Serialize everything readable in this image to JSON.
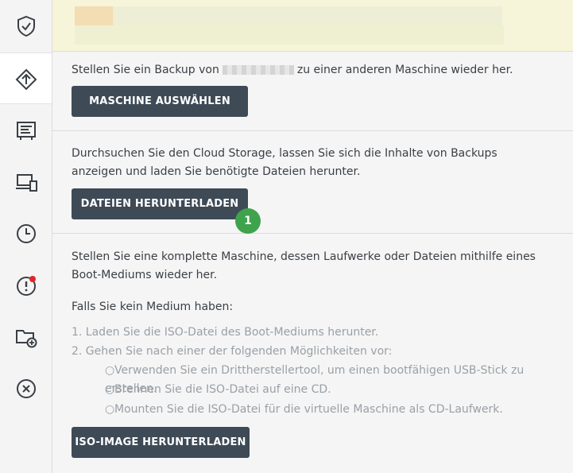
{
  "sidebar": {
    "items": [
      {
        "name": "shield-check-icon",
        "active": false
      },
      {
        "name": "restore-icon",
        "active": true
      },
      {
        "name": "backup-storage-icon",
        "active": false
      },
      {
        "name": "devices-icon",
        "active": false
      },
      {
        "name": "clock-icon",
        "active": false
      },
      {
        "name": "alert-icon",
        "active": false,
        "notification": true
      },
      {
        "name": "folder-add-icon",
        "active": false
      },
      {
        "name": "close-circle-icon",
        "active": false
      }
    ]
  },
  "section1": {
    "text_before": "Stellen Sie ein Backup von",
    "text_after": "zu einer anderen Maschine wieder her.",
    "button": "MASCHINE AUSWÄHLEN"
  },
  "section2": {
    "text": "Durchsuchen Sie den Cloud Storage, lassen Sie sich die Inhalte von Backups anzeigen und laden Sie benötigte Dateien herunter.",
    "button": "DATEIEN HERUNTERLADEN",
    "badge": "1"
  },
  "section3": {
    "text": "Stellen Sie eine komplette Maschine, dessen Laufwerke oder Dateien mithilfe eines Boot-Mediums wieder her.",
    "no_medium": "Falls Sie kein Medium haben:",
    "steps": [
      "1. Laden Sie die ISO-Datei des Boot-Mediums herunter.",
      "2. Gehen Sie nach einer der folgenden Möglichkeiten vor:"
    ],
    "bullets": [
      "Verwenden Sie ein Drittherstellertool, um einen bootfähigen USB-Stick zu erstellen.",
      "Brennen Sie die ISO-Datei auf eine CD.",
      "Mounten Sie die ISO-Datei für die virtuelle Maschine als CD-Laufwerk."
    ],
    "bullet_symbol": "○",
    "button": "ISO-IMAGE HERUNTERLADEN"
  },
  "colors": {
    "button_bg": "#3e4a56",
    "badge": "#3fa34d",
    "notification": "#e0262b",
    "banner": "#f7f5d9"
  }
}
